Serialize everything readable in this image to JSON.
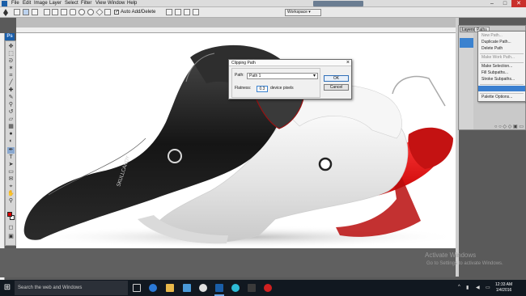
{
  "menubar": {
    "items": [
      "File",
      "Edit",
      "Image",
      "Layer",
      "Select",
      "Filter",
      "View",
      "Window",
      "Help"
    ],
    "window_controls": {
      "minimize": "–",
      "maximize": "□",
      "close": "✕"
    }
  },
  "options_bar": {
    "auto_add_delete_label": "Auto Add/Delete",
    "auto_add_delete_checked": true,
    "workspace_label": "Workspace ▾"
  },
  "app_badge": "Ps",
  "toolbox": {
    "foreground_color": "#dd0000",
    "background_color": "#ffffff"
  },
  "paths_panel": {
    "tabs": [
      "Layers",
      "Paths"
    ],
    "active_tab": "Paths",
    "footer_icons": "○ ○ ◇ ◇ ▣ ▭"
  },
  "panel_menu": {
    "items": [
      {
        "label": "New Path...",
        "state": "disabled"
      },
      {
        "label": "Duplicate Path...",
        "state": "enabled"
      },
      {
        "label": "Delete Path",
        "state": "enabled"
      },
      {
        "label": "Make Work Path...",
        "state": "disabled"
      },
      {
        "label": "Make Selection...",
        "state": "enabled"
      },
      {
        "label": "Fill Subpaths...",
        "state": "enabled"
      },
      {
        "label": "Stroke Subpaths...",
        "state": "enabled"
      },
      {
        "label": "",
        "state": "highlighted"
      },
      {
        "label": "Palette Options...",
        "state": "enabled"
      }
    ]
  },
  "clipping_dialog": {
    "title": "Clipping Path",
    "close": "×",
    "path_label": "Path:",
    "path_value": "Path 1",
    "flatness_label": "Flatness:",
    "flatness_value": "0.3",
    "flatness_unit": "device pixels",
    "ok_label": "OK",
    "cancel_label": "Cancel"
  },
  "watermark": {
    "line1": "Activate Windows",
    "line2": "Go to Settings to activate Windows."
  },
  "taskbar": {
    "start_icon": "⊞",
    "search_placeholder": "Search the web and Windows",
    "time": "12:33 AM",
    "date": "1/4/2016"
  },
  "colors": {
    "accent": "#3a7fd0",
    "headphone_red": "#d51010",
    "headphone_black": "#1c1c1c"
  }
}
